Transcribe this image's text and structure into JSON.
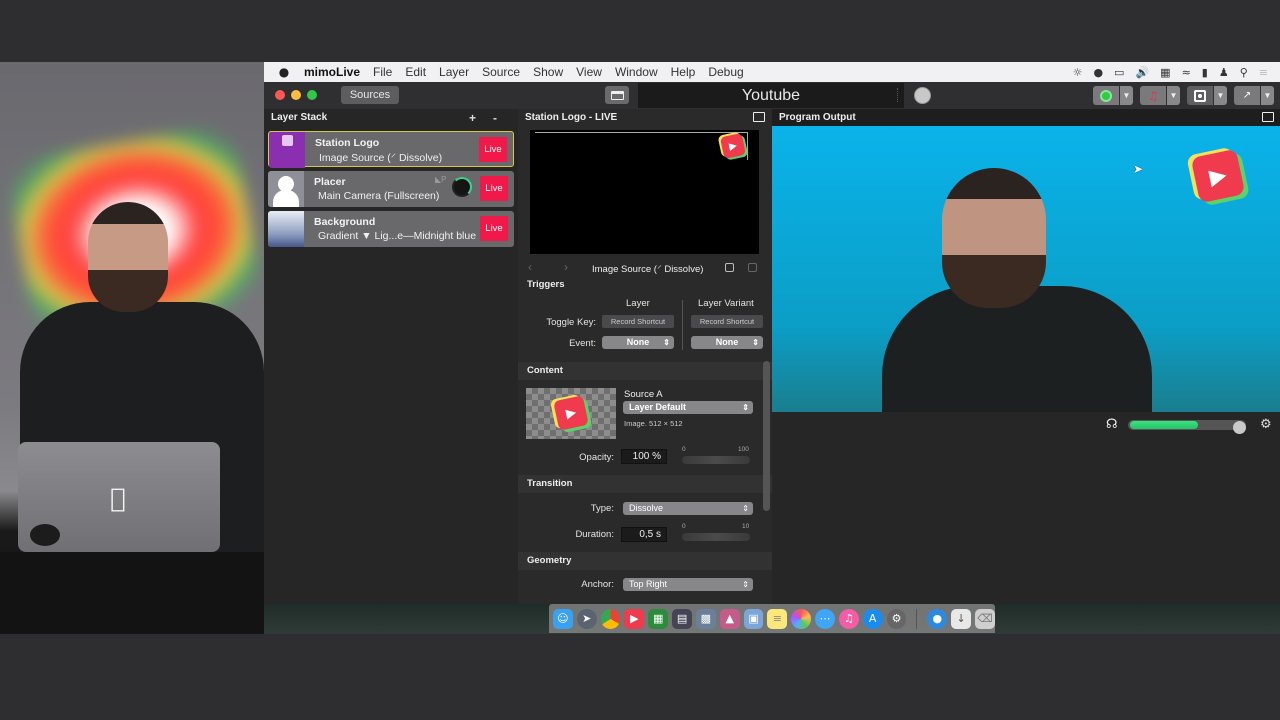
{
  "menubar": {
    "app_name": "mimoLive",
    "menus": [
      "File",
      "Edit",
      "Layer",
      "Source",
      "Show",
      "View",
      "Window",
      "Help",
      "Debug"
    ],
    "status_icons": [
      "brightness-icon",
      "coffee-cup-icon",
      "airplay-icon",
      "volume-icon",
      "battery-meter-icon",
      "wifi-icon",
      "battery-icon",
      "user-icon",
      "spotlight-search-icon",
      "notification-center-icon"
    ]
  },
  "toolbar": {
    "sources_label": "Sources",
    "document_name": "Youtube",
    "groups": [
      {
        "name": "live-streaming",
        "icon": "stream-status-icon",
        "color": "#2ecc40"
      },
      {
        "name": "recording",
        "icon": "record-broadcast-icon",
        "color": "#e8334a"
      },
      {
        "name": "output-destination",
        "icon": "disk-output-icon",
        "color": "#ffffff"
      },
      {
        "name": "fullscreen",
        "icon": "expand-icon",
        "color": "#ffffff"
      }
    ]
  },
  "layer_stack": {
    "title": "Layer Stack",
    "add_label": "+",
    "remove_label": "-",
    "layers": [
      {
        "title": "Station Logo",
        "subtitle": "Image Source (⸍ Dissolve)",
        "live_label": "Live",
        "selected": true
      },
      {
        "title": "Placer",
        "subtitle": "Main Camera (Fullscreen)",
        "live_label": "Live",
        "selected": false
      },
      {
        "title": "Background",
        "subtitle": "Gradient ▼ Lig...e—Midnight blue",
        "live_label": "Live",
        "selected": false
      }
    ]
  },
  "layer_editor": {
    "title": "Station Logo - LIVE",
    "variant_name": "Image Source (⸍ Dissolve)",
    "triggers": {
      "heading": "Triggers",
      "col_layer": "Layer",
      "col_variant": "Layer Variant",
      "toggle_key_label": "Toggle Key:",
      "record_shortcut_label": "Record Shortcut",
      "event_label": "Event:",
      "event_layer_value": "None",
      "event_variant_value": "None"
    },
    "content": {
      "heading": "Content",
      "source_label": "Source A",
      "source_value": "Layer Default",
      "image_info": "Image. 512 × 512",
      "opacity_label": "Opacity:",
      "opacity_value": "100 %",
      "opacity_min": "0",
      "opacity_max": "100",
      "opacity_fraction": 1.0
    },
    "transition": {
      "heading": "Transition",
      "type_label": "Type:",
      "type_value": "Dissolve",
      "duration_label": "Duration:",
      "duration_value": "0,5 s",
      "duration_min": "0",
      "duration_max": "10"
    },
    "geometry": {
      "heading": "Geometry",
      "anchor_label": "Anchor:",
      "anchor_value": "Top Right"
    }
  },
  "program_output": {
    "title": "Program Output",
    "audio_level_fraction": 0.6,
    "audio_volume_fraction": 1.0
  },
  "dock": {
    "apps": [
      "finder-icon",
      "launchpad-icon",
      "chrome-icon",
      "mimolive-icon",
      "app-5-icon",
      "app-6-icon",
      "app-7-icon",
      "app-8-icon",
      "preview-icon",
      "notes-icon",
      "photos-icon",
      "messages-icon",
      "itunes-icon",
      "app-store-icon",
      "system-preferences-icon"
    ],
    "extras": [
      "network-globe-icon",
      "downloads-icon",
      "trash-icon"
    ]
  }
}
